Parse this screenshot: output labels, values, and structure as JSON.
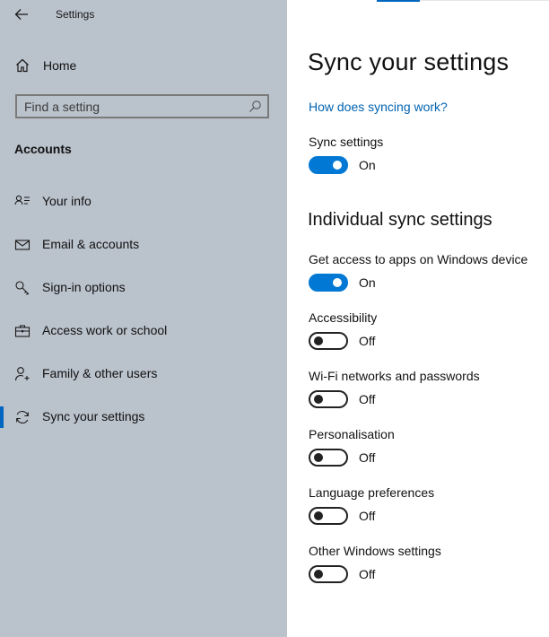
{
  "window": {
    "title": "Settings"
  },
  "sidebar": {
    "home_label": "Home",
    "search_placeholder": "Find a setting",
    "section": "Accounts",
    "items": [
      {
        "label": "Your info",
        "icon": "contact-info-icon",
        "active": false
      },
      {
        "label": "Email & accounts",
        "icon": "mail-icon",
        "active": false
      },
      {
        "label": "Sign-in options",
        "icon": "key-icon",
        "active": false
      },
      {
        "label": "Access work or school",
        "icon": "briefcase-icon",
        "active": false
      },
      {
        "label": "Family & other users",
        "icon": "add-user-icon",
        "active": false
      },
      {
        "label": "Sync your settings",
        "icon": "sync-icon",
        "active": true
      }
    ]
  },
  "main": {
    "title": "Sync your settings",
    "help_link": "How does syncing work?",
    "sync_settings": {
      "label": "Sync settings",
      "state": "On",
      "on": true
    },
    "individual_header": "Individual sync settings",
    "individual": [
      {
        "label": "Get access to apps on Windows device",
        "state": "On",
        "on": true
      },
      {
        "label": "Accessibility",
        "state": "Off",
        "on": false
      },
      {
        "label": "Wi-Fi networks and passwords",
        "state": "Off",
        "on": false
      },
      {
        "label": "Personalisation",
        "state": "Off",
        "on": false
      },
      {
        "label": "Language preferences",
        "state": "Off",
        "on": false
      },
      {
        "label": "Other Windows settings",
        "state": "Off",
        "on": false
      }
    ]
  },
  "colors": {
    "sidebar_bg": "#bac2cc",
    "accent": "#0078d4",
    "link": "#0063b1"
  }
}
